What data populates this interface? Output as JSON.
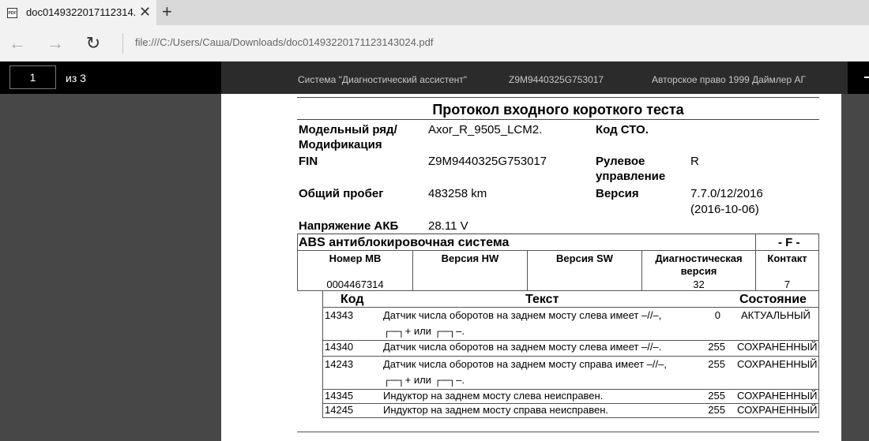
{
  "browser": {
    "tab_title": "doc0149322017112314...",
    "url": "file:///C:/Users/Саша/Downloads/doc01493220171123143024.pdf"
  },
  "pdf_toolbar": {
    "page_number": "1",
    "page_total": "из 3"
  },
  "page_header": {
    "system": "Система \"Диагностический ассистент\"",
    "fin": "Z9M9440325G753017",
    "copyright": "Авторское право 1999 Даймлер АГ"
  },
  "doc": {
    "title": "Протокол входного короткого теста",
    "fields": {
      "model_label": "Модельный ряд/Модификация",
      "model_value": "Axor_R_9505_LCM2.",
      "sto_label": "Код СТО.",
      "fin_label": "FIN",
      "fin_value": "Z9M9440325G753017",
      "steering_label": "Рулевое управление",
      "steering_value": "R",
      "mileage_label": "Общий пробег",
      "mileage_value": "483258 km",
      "version_label": "Версия",
      "version_value_1": "7.7.0/12/2016",
      "version_value_2": "(2016-10-06)",
      "battery_label": "Напряжение АКБ",
      "battery_value": "28.11 V"
    },
    "abs": {
      "title": "ABS антиблокировочная система",
      "flag": "- F -",
      "columns": {
        "mb": "Номер MB",
        "hw": "Версия HW",
        "sw": "Версия SW",
        "diag": "Диагностическая версия",
        "contact": "Контакт"
      },
      "values": {
        "mb": "0004467314",
        "hw": "",
        "sw": "",
        "diag": "32",
        "contact": "7"
      }
    },
    "faults": {
      "headers": {
        "code": "Код",
        "text": "Текст",
        "state": "Состояние"
      },
      "rows": [
        {
          "code": "14343",
          "text": "Датчик числа оборотов на заднем мосту слева имеет –//–,",
          "text2": "┌─┐+ или ┌─┐–.",
          "num": "0",
          "state": "АКТУАЛЬНЫЙ"
        },
        {
          "code": "14340",
          "text": "Датчик числа оборотов на заднем мосту слева имеет –//–.",
          "num": "255",
          "state": "СОХРАНЕННЫЙ"
        },
        {
          "code": "14243",
          "text": "Датчик числа оборотов на заднем мосту справа имеет –//–,",
          "text2": "┌─┐+ или ┌─┐–.",
          "num": "255",
          "state": "СОХРАНЕННЫЙ"
        },
        {
          "code": "14345",
          "text": "Индуктор на заднем мосту слева неисправен.",
          "num": "255",
          "state": "СОХРАНЕННЫЙ"
        },
        {
          "code": "14245",
          "text": "Индуктор на заднем мосту справа неисправен.",
          "num": "255",
          "state": "СОХРАНЕННЫЙ"
        }
      ]
    }
  }
}
